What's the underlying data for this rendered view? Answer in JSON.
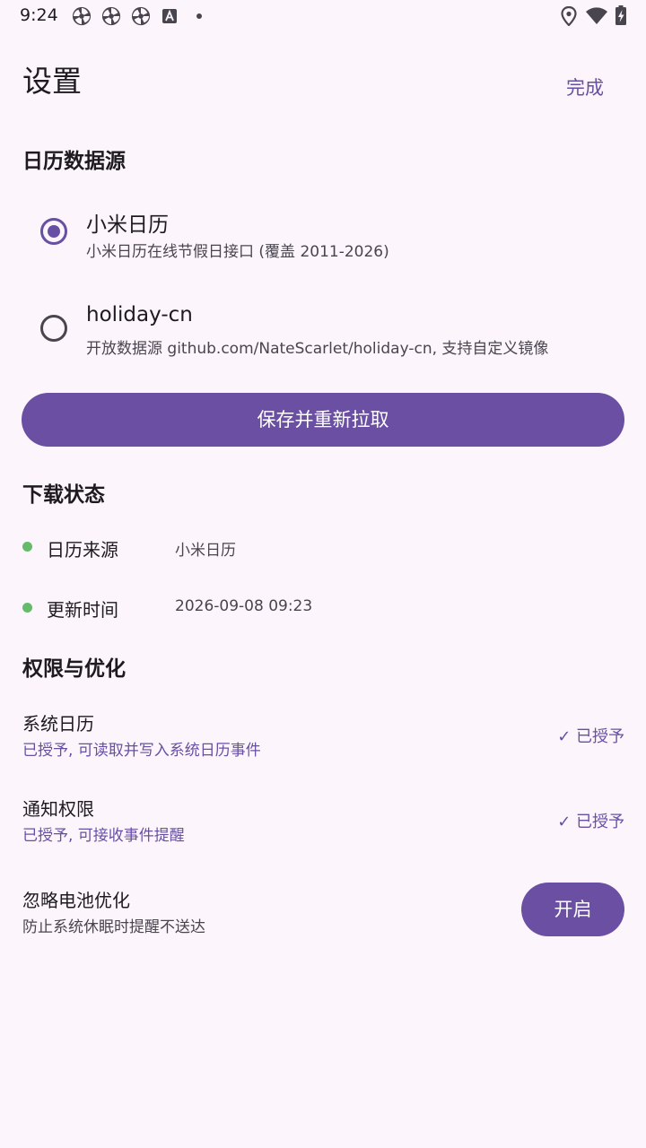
{
  "status_bar": {
    "time": "9:24",
    "notification_icons": [
      "pinwheel-icon",
      "pinwheel-icon",
      "pinwheel-icon",
      "keyboard-a-icon"
    ],
    "right_icons": [
      "location-icon",
      "wifi-icon",
      "battery-charging-icon"
    ]
  },
  "header": {
    "title": "设置",
    "done_label": "完成"
  },
  "data_source": {
    "section_title": "日历数据源",
    "options": [
      {
        "title": "小米日历",
        "description": "小米日历在线节假日接口 (覆盖 2011-2026)",
        "selected": true
      },
      {
        "title": "holiday-cn",
        "description": "开放数据源 github.com/NateScarlet/holiday-cn, 支持自定义镜像",
        "selected": false
      }
    ],
    "save_button_label": "保存并重新拉取"
  },
  "download_status": {
    "section_title": "下载状态",
    "items": [
      {
        "label": "日历来源",
        "value": "小米日历"
      },
      {
        "label": "更新时间",
        "value": "2026-09-08 09:23"
      }
    ]
  },
  "permissions": {
    "section_title": "权限与优化",
    "items": [
      {
        "title": "系统日历",
        "description": "已授予, 可读取并写入系统日历事件",
        "state": "✓ 已授予"
      },
      {
        "title": "通知权限",
        "description": "已授予, 可接收事件提醒",
        "state": "✓ 已授予"
      },
      {
        "title": "忽略电池优化",
        "description": "防止系统休眠时提醒不送达",
        "button_label": "开启"
      }
    ]
  },
  "colors": {
    "background": "#fcf5fc",
    "primary": "#6a4fa3",
    "status_green": "#66bb6a",
    "text_primary": "#1d1b20",
    "text_secondary": "#49454f"
  }
}
